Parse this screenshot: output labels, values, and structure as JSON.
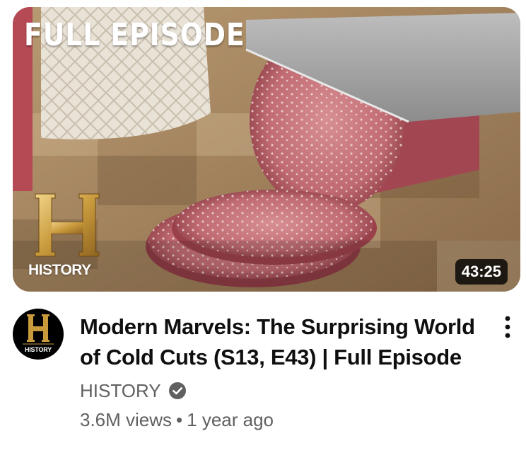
{
  "thumbnail": {
    "overlay_title": "FULL EPISODE",
    "logo_text": "HISTORY",
    "duration": "43:25"
  },
  "channel": {
    "avatar_text": "HISTORY",
    "name": "HISTORY",
    "verified": true
  },
  "video": {
    "title": "Modern Marvels: The Surprising World of Cold Cuts (S13, E43) | Full Episode",
    "views": "3.6M views",
    "separator": "•",
    "age": "1 year ago"
  },
  "icons": {
    "menu": "more-vert-icon",
    "verified": "verified-check-icon",
    "brand": "history-h-logo-icon"
  },
  "colors": {
    "title_text": "#0f0f0f",
    "secondary_text": "#606060",
    "duration_bg": "#000000cc",
    "logo_gold": "#c99a3c"
  }
}
